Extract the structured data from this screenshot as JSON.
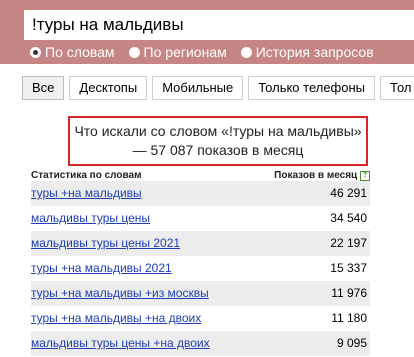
{
  "search": {
    "value": "!туры на мальдивы"
  },
  "modes": [
    {
      "label": "По словам",
      "selected": true
    },
    {
      "label": "По регионам",
      "selected": false
    },
    {
      "label": "История запросов",
      "selected": false
    }
  ],
  "tabs": [
    "Все",
    "Десктопы",
    "Мобильные",
    "Только телефоны",
    "Тол"
  ],
  "summary": {
    "text": "Что искали со словом «!туры на мальдивы» — 57 087 показов в месяц"
  },
  "table": {
    "col_words": "Статистика по словам",
    "col_shows": "Показов в месяц",
    "help": "?",
    "rows": [
      {
        "phrase": "туры +на мальдивы",
        "count": "46 291"
      },
      {
        "phrase": "мальдивы туры цены",
        "count": "34 540"
      },
      {
        "phrase": "мальдивы туры цены 2021",
        "count": "22 197"
      },
      {
        "phrase": "туры +на мальдивы 2021",
        "count": "15 337"
      },
      {
        "phrase": "туры +на мальдивы +из москвы",
        "count": "11 976"
      },
      {
        "phrase": "туры +на мальдивы +на двоих",
        "count": "11 180"
      },
      {
        "phrase": "мальдивы туры цены +на двоих",
        "count": "9 095"
      }
    ]
  }
}
